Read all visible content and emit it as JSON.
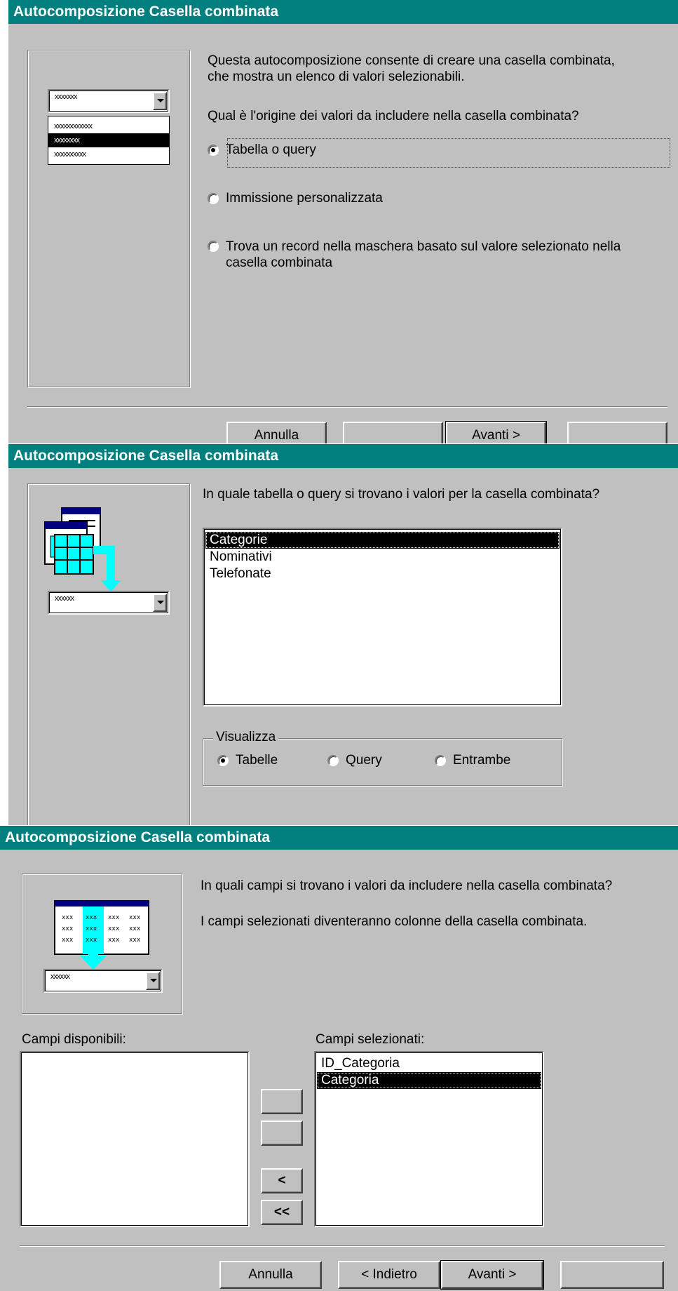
{
  "panel1": {
    "title": "Autocomposizione Casella combinata",
    "intro": "Questa autocomposizione consente di creare una casella combinata, che mostra un elenco di valori selezionabili.",
    "question": "Qual è l'origine dei valori da includere nella casella combinata?",
    "options": [
      {
        "label": "Tabella o query",
        "checked": true
      },
      {
        "label": "Immissione personalizzata",
        "checked": false
      },
      {
        "label": "Trova un record nella maschera basato sul valore selezionato nella casella combinata",
        "checked": false
      }
    ],
    "illustration": {
      "combo_text": "xxxxxxx",
      "items": [
        "xxxxxxxxxxxx",
        "xxxxxxxx",
        "xxxxxxxxxx"
      ]
    },
    "buttons": {
      "cancel": "Annulla",
      "back": "",
      "next": "Avanti >",
      "finish": ""
    }
  },
  "panel2": {
    "title": "Autocomposizione Casella combinata",
    "question": "In quale tabella o query si trovano i valori per la casella combinata?",
    "list_items": [
      "Categorie",
      "Nominativi",
      "Telefonate"
    ],
    "selected_index": 0,
    "group_label": "Visualizza",
    "view_options": [
      {
        "label": "Tabelle",
        "checked": true
      },
      {
        "label": "Query",
        "checked": false
      },
      {
        "label": "Entrambe",
        "checked": false
      }
    ],
    "illustration": {
      "combo_text": "xxxxxx"
    }
  },
  "panel3": {
    "title": "Autocomposizione Casella combinata",
    "question": "In quali campi si trovano i valori da includere nella casella combinata?",
    "note": "I campi selezionati diventeranno colonne della casella combinata.",
    "available_label": "Campi disponibili:",
    "selected_label": "Campi selezionati:",
    "available_fields": [],
    "selected_fields": [
      "ID_Categoria",
      "Categoria"
    ],
    "selected_index": 1,
    "move_buttons": [
      "",
      "",
      "<",
      "<<"
    ],
    "illustration": {
      "combo_text": "xxxxxx",
      "cell_text": "xxx"
    },
    "buttons": {
      "cancel": "Annulla",
      "back": "< Indietro",
      "next": "Avanti >",
      "finish": ""
    }
  },
  "colors": {
    "titlebar": "#007f7f",
    "face": "#c0c0c0",
    "illustration_accent": "#00ffff"
  }
}
